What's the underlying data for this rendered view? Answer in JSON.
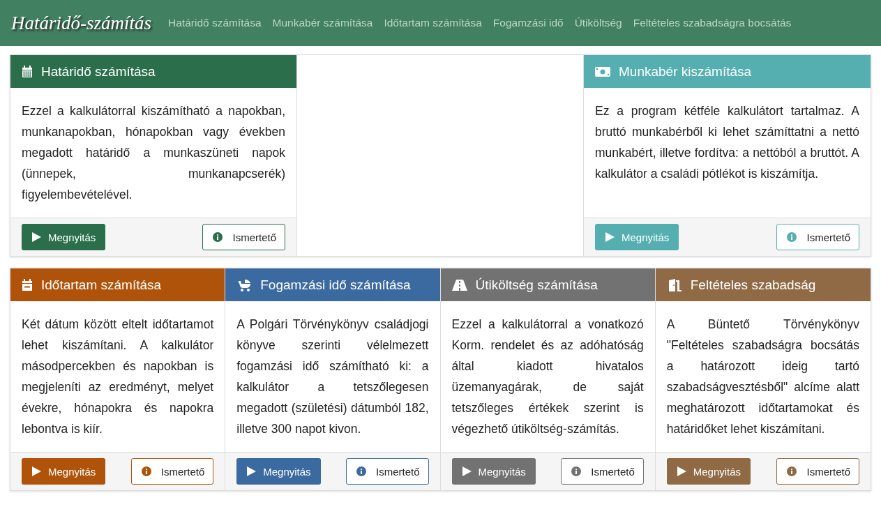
{
  "brand": "Határidő-számítás",
  "nav": [
    "Határidő számítása",
    "Munkabér számítása",
    "Időtartam számítása",
    "Fogamzási idő",
    "Útiköltség",
    "Feltételes szabadságra bocsátás"
  ],
  "rows": [
    {
      "slots": [
        {
          "kind": "calendar",
          "color": "#2a6e4b",
          "title": "Határidő számítása",
          "text": "Ezzel a kalkulátorral kiszámítható a napokban, munkanapokban, hónapokban vagy években megadott határidő a munkaszüneti napok (ünnepek, munkanapcserék) figyelembevételével.",
          "open": "Megnyitás",
          "info": "Ismertető"
        },
        {
          "kind": "blank"
        },
        {
          "kind": "money",
          "color": "#55afb0",
          "title": "Munkabér kiszámítása",
          "text": "Ez a program kétféle kalkulátort tartalmaz. A bruttó munkabérből ki lehet számíttatni a nettó munkabért, illetve fordítva: a nettóból a bruttót. A kalkulátor a családi pótlékot is kiszámítja.",
          "open": "Megnyitás",
          "info": "Ismertető"
        }
      ]
    },
    {
      "slots": [
        {
          "kind": "calendar-minus",
          "color": "#b0530a",
          "title": "Időtartam számítása",
          "text": "Két dátum között eltelt időtartamot lehet kiszámítani. A kalkulátor másodpercekben és napokban is megjeleníti az eredményt, melyet évekre, hónapokra és napokra lebontva is kiír.",
          "open": "Megnyitás",
          "info": "Ismertető"
        },
        {
          "kind": "stroller",
          "color": "#3b6aa0",
          "title": "Fogamzási idő számítása",
          "text": "A Polgári Törvénykönyv családjogi könyve szerinti vélelmezett fogamzási idő számítható ki: a kalkulátor a tetszőlegesen megadott (születési) dátumból 182, illetve 300 napot kivon.",
          "open": "Megnyitás",
          "info": "Ismertető"
        },
        {
          "kind": "road",
          "color": "#727272",
          "title": "Útiköltség számítása",
          "text": "Ezzel a kalkulátorral a vonatkozó Korm. rendelet és az adóhatóság által kiadott hivatalos üzemanyagárak, de saját tetszőleges értékek szerint is végezhető útiköltség-számítás.",
          "open": "Megnyitás",
          "info": "Ismertető"
        },
        {
          "kind": "door",
          "color": "#8f6a45",
          "title": "Feltételes szabadság",
          "text": "A Büntető Törvénykönyv \"Feltételes szabadságra bocsátás a határozott ideig tartó szabadságvesztésből\" alcíme alatt meghatározott időtartamokat és határidőket lehet kiszámítani.",
          "open": "Megnyitás",
          "info": "Ismertető"
        }
      ]
    }
  ]
}
